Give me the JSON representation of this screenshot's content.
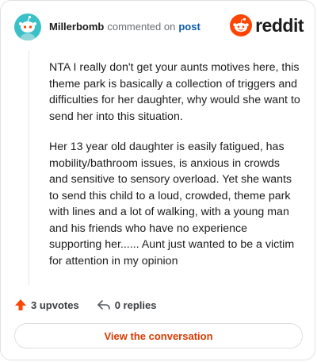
{
  "header": {
    "username": "Millerbomb",
    "verb": "commented on",
    "link": "post",
    "brand": "reddit"
  },
  "comment": {
    "paragraphs": [
      "NTA I really don't get your aunts motives here, this theme park is basically a collection of triggers and difficulties for her daughter, why would she want to send her into this situation.",
      "Her 13 year old daughter is easily fatigued, has mobility/bathroom issues, is anxious in crowds and sensitive to sensory overload. Yet she wants to send this child to a loud, crowded, theme park with lines and a lot of walking, with a young man and his friends who have no experience supporting her...... Aunt just wanted to be a victim for attention in my opinion"
    ]
  },
  "actions": {
    "upvotes": "3 upvotes",
    "replies": "0 replies"
  },
  "cta": {
    "label": "View the conversation"
  },
  "colors": {
    "brand": "#ff4500",
    "link": "#0b5aa8",
    "cta_text": "#d93a00",
    "avatar_bg": "#3bc0c8"
  }
}
